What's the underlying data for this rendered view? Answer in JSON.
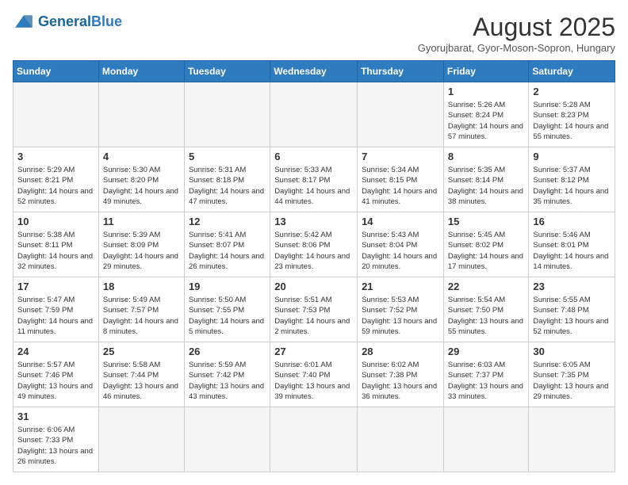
{
  "header": {
    "logo_general": "General",
    "logo_blue": "Blue",
    "month_title": "August 2025",
    "location": "Gyorujbarat, Gyor-Moson-Sopron, Hungary"
  },
  "weekdays": [
    "Sunday",
    "Monday",
    "Tuesday",
    "Wednesday",
    "Thursday",
    "Friday",
    "Saturday"
  ],
  "weeks": [
    [
      {
        "day": "",
        "info": ""
      },
      {
        "day": "",
        "info": ""
      },
      {
        "day": "",
        "info": ""
      },
      {
        "day": "",
        "info": ""
      },
      {
        "day": "",
        "info": ""
      },
      {
        "day": "1",
        "info": "Sunrise: 5:26 AM\nSunset: 8:24 PM\nDaylight: 14 hours and 57 minutes."
      },
      {
        "day": "2",
        "info": "Sunrise: 5:28 AM\nSunset: 8:23 PM\nDaylight: 14 hours and 55 minutes."
      }
    ],
    [
      {
        "day": "3",
        "info": "Sunrise: 5:29 AM\nSunset: 8:21 PM\nDaylight: 14 hours and 52 minutes."
      },
      {
        "day": "4",
        "info": "Sunrise: 5:30 AM\nSunset: 8:20 PM\nDaylight: 14 hours and 49 minutes."
      },
      {
        "day": "5",
        "info": "Sunrise: 5:31 AM\nSunset: 8:18 PM\nDaylight: 14 hours and 47 minutes."
      },
      {
        "day": "6",
        "info": "Sunrise: 5:33 AM\nSunset: 8:17 PM\nDaylight: 14 hours and 44 minutes."
      },
      {
        "day": "7",
        "info": "Sunrise: 5:34 AM\nSunset: 8:15 PM\nDaylight: 14 hours and 41 minutes."
      },
      {
        "day": "8",
        "info": "Sunrise: 5:35 AM\nSunset: 8:14 PM\nDaylight: 14 hours and 38 minutes."
      },
      {
        "day": "9",
        "info": "Sunrise: 5:37 AM\nSunset: 8:12 PM\nDaylight: 14 hours and 35 minutes."
      }
    ],
    [
      {
        "day": "10",
        "info": "Sunrise: 5:38 AM\nSunset: 8:11 PM\nDaylight: 14 hours and 32 minutes."
      },
      {
        "day": "11",
        "info": "Sunrise: 5:39 AM\nSunset: 8:09 PM\nDaylight: 14 hours and 29 minutes."
      },
      {
        "day": "12",
        "info": "Sunrise: 5:41 AM\nSunset: 8:07 PM\nDaylight: 14 hours and 26 minutes."
      },
      {
        "day": "13",
        "info": "Sunrise: 5:42 AM\nSunset: 8:06 PM\nDaylight: 14 hours and 23 minutes."
      },
      {
        "day": "14",
        "info": "Sunrise: 5:43 AM\nSunset: 8:04 PM\nDaylight: 14 hours and 20 minutes."
      },
      {
        "day": "15",
        "info": "Sunrise: 5:45 AM\nSunset: 8:02 PM\nDaylight: 14 hours and 17 minutes."
      },
      {
        "day": "16",
        "info": "Sunrise: 5:46 AM\nSunset: 8:01 PM\nDaylight: 14 hours and 14 minutes."
      }
    ],
    [
      {
        "day": "17",
        "info": "Sunrise: 5:47 AM\nSunset: 7:59 PM\nDaylight: 14 hours and 11 minutes."
      },
      {
        "day": "18",
        "info": "Sunrise: 5:49 AM\nSunset: 7:57 PM\nDaylight: 14 hours and 8 minutes."
      },
      {
        "day": "19",
        "info": "Sunrise: 5:50 AM\nSunset: 7:55 PM\nDaylight: 14 hours and 5 minutes."
      },
      {
        "day": "20",
        "info": "Sunrise: 5:51 AM\nSunset: 7:53 PM\nDaylight: 14 hours and 2 minutes."
      },
      {
        "day": "21",
        "info": "Sunrise: 5:53 AM\nSunset: 7:52 PM\nDaylight: 13 hours and 59 minutes."
      },
      {
        "day": "22",
        "info": "Sunrise: 5:54 AM\nSunset: 7:50 PM\nDaylight: 13 hours and 55 minutes."
      },
      {
        "day": "23",
        "info": "Sunrise: 5:55 AM\nSunset: 7:48 PM\nDaylight: 13 hours and 52 minutes."
      }
    ],
    [
      {
        "day": "24",
        "info": "Sunrise: 5:57 AM\nSunset: 7:46 PM\nDaylight: 13 hours and 49 minutes."
      },
      {
        "day": "25",
        "info": "Sunrise: 5:58 AM\nSunset: 7:44 PM\nDaylight: 13 hours and 46 minutes."
      },
      {
        "day": "26",
        "info": "Sunrise: 5:59 AM\nSunset: 7:42 PM\nDaylight: 13 hours and 43 minutes."
      },
      {
        "day": "27",
        "info": "Sunrise: 6:01 AM\nSunset: 7:40 PM\nDaylight: 13 hours and 39 minutes."
      },
      {
        "day": "28",
        "info": "Sunrise: 6:02 AM\nSunset: 7:38 PM\nDaylight: 13 hours and 36 minutes."
      },
      {
        "day": "29",
        "info": "Sunrise: 6:03 AM\nSunset: 7:37 PM\nDaylight: 13 hours and 33 minutes."
      },
      {
        "day": "30",
        "info": "Sunrise: 6:05 AM\nSunset: 7:35 PM\nDaylight: 13 hours and 29 minutes."
      }
    ],
    [
      {
        "day": "31",
        "info": "Sunrise: 6:06 AM\nSunset: 7:33 PM\nDaylight: 13 hours and 26 minutes."
      },
      {
        "day": "",
        "info": ""
      },
      {
        "day": "",
        "info": ""
      },
      {
        "day": "",
        "info": ""
      },
      {
        "day": "",
        "info": ""
      },
      {
        "day": "",
        "info": ""
      },
      {
        "day": "",
        "info": ""
      }
    ]
  ]
}
